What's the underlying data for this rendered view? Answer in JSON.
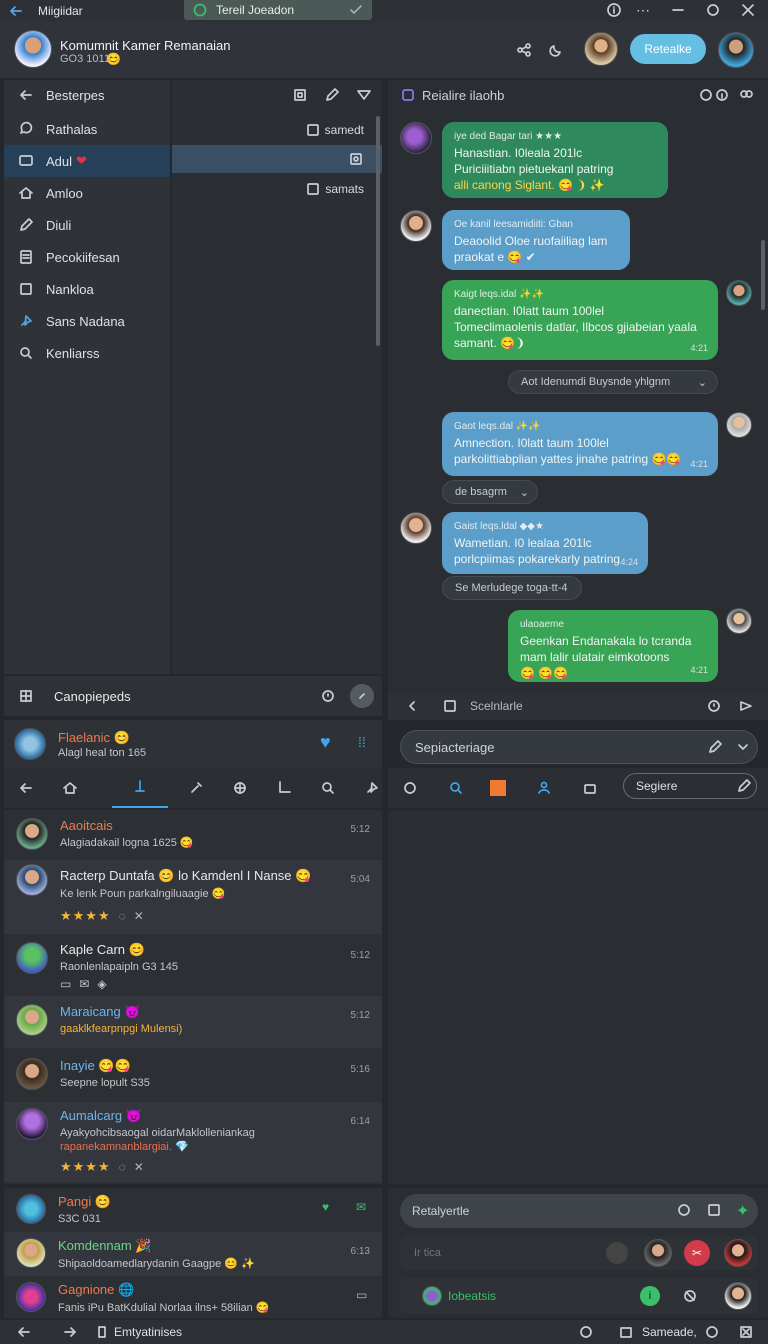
{
  "titlebar": {
    "app_name": "Miigiidar",
    "tab_title": "Tereil Joeadon"
  },
  "header": {
    "title": "Komumnit Kamer Remanaian",
    "subtitle": "GO3 1011",
    "action_pill": "Retealke"
  },
  "nav": {
    "back_label": "Besterpes",
    "items": [
      {
        "label": "Rathalas",
        "icon": "chat-icon"
      },
      {
        "label": "Adul",
        "icon": "message-icon",
        "active": true
      },
      {
        "label": "Amloo",
        "icon": "home-icon"
      },
      {
        "label": "Diuli",
        "icon": "edit-icon"
      },
      {
        "label": "Pecokiifesan",
        "icon": "document-icon"
      },
      {
        "label": "Nankloa",
        "icon": "box-icon"
      },
      {
        "label": "Sans Nadana",
        "icon": "pin-icon"
      },
      {
        "label": "Kenliarss",
        "icon": "search-icon"
      }
    ],
    "footer_label": "Canopiepeds"
  },
  "midpanel": {
    "items": [
      "samedt",
      "",
      "samats"
    ]
  },
  "chat": {
    "header_title": "Reialire ilaohb",
    "messages": [
      {
        "l1": "iye ded Bagar tari ★★★",
        "l2": "Hanastian. I0leala 201lc",
        "l3": "Puriciiitiabn pietuekanl patring",
        "l4": "alli canong Siglant. 😋 ❩  ✨"
      },
      {
        "l1": "Oe kanil leesamidiiti: Gban",
        "l2": "Deaoolid Oloe ruofaiiliag lam",
        "l3": "praokat e 😋  ✔"
      },
      {
        "l1": "Kaigt leqs.idal ✨✨",
        "l2": "danectian. I0latt taum 100lel",
        "l3": "Tomeclimaolenis datlar, Ilbcos gjiabeian yaala",
        "l4": "samant. 😋❩",
        "time": "4:21"
      },
      {
        "l1": "Gaot leqs.dal ✨✨",
        "l2": "Amnection. I0latt taum 100lel",
        "l3": "parkolittiabplian yattes jinahe patring 😋😋",
        "time": "4:21"
      },
      {
        "l1": "Gaist leqs.ldal ◆◆★",
        "l2": "Wametian. I0 lealaa 201lc",
        "l3": "porlcpiimas pokarekarly patring",
        "time": "4:24"
      },
      {
        "l1": "ulaoaeme",
        "l2": "Geenkan Endanakala lo tcranda",
        "l3": "mam lalir ulatair eimkotoons",
        "l4": "😋 😋😋",
        "time": "4:21"
      }
    ],
    "system_notes": [
      "Aot Idenumdi Buysnde yhlgnm",
      "de bsagrm",
      "Se Merludege toga-tt-4"
    ],
    "footer_label": "Scelnlarle"
  },
  "profile": {
    "name": "Flaelanic 😊",
    "sub": "Alagl heal ton 165"
  },
  "contacts": [
    {
      "name": "Aaoitcais",
      "sub": "Alagiadakail logna 1625 😋",
      "time": "5:12",
      "name_color": "#f07a4a"
    },
    {
      "name": "Racterp Duntafa 😊 lo Kamdenl I Nanse 😋",
      "sub": "Ke lenk Poun parkalngiluaagie 😋",
      "time": "5:04",
      "stars": "★★★★",
      "name_color": "#f3f4f5"
    },
    {
      "name": "Kaple Carn 😊",
      "sub": "Raonlenlapaipln G3 145",
      "time": "5:12",
      "name_color": "#f3f4f5"
    },
    {
      "name": "Maraicang 😈",
      "sub": "gaaklkfearpnpgi Mulensi)",
      "time": "5:12",
      "name_color": "#6fb4ea",
      "sub_color": "#f3b43a"
    },
    {
      "name": "Inayie 😋😋",
      "sub": "Seepne lopult S35",
      "time": "5:16",
      "name_color": "#6fb4ea"
    },
    {
      "name": "Aumalcarg 😈",
      "sub": "Ayakyohcibsaogal oidarMaklolleniankag",
      "sub2": "rapanekamnanblargiai.  💎",
      "time": "6:14",
      "stars": "★★★★",
      "name_color": "#6fb4ea",
      "sub2_color": "#e96f4f"
    }
  ],
  "right_search": {
    "label": "Sepiacteriage"
  },
  "right_tools": {
    "search_label": "Segiere"
  },
  "bottom_left": [
    {
      "name": "Pangi 😊",
      "sub": "S3C 031",
      "name_color": "#f07a4a"
    },
    {
      "name": "Komdennam 🎉",
      "sub": "Shipaoldoamedlarydanin Gaagpe 😊 ✨",
      "name_color": "#6fd48a"
    },
    {
      "name": "Gagnione 🌐",
      "sub": "Fanis iPu BatKdulial Norlaa ilns+ 58ilian 😋",
      "name_color": "#f07a4a"
    }
  ],
  "bottom_right": {
    "input_label": "Retalyertle",
    "placeholder": "Ir tica",
    "channel_label": "Iobeatsis"
  },
  "statusbar": {
    "label": "Emtyatinises",
    "right_label": "Sameade,"
  }
}
